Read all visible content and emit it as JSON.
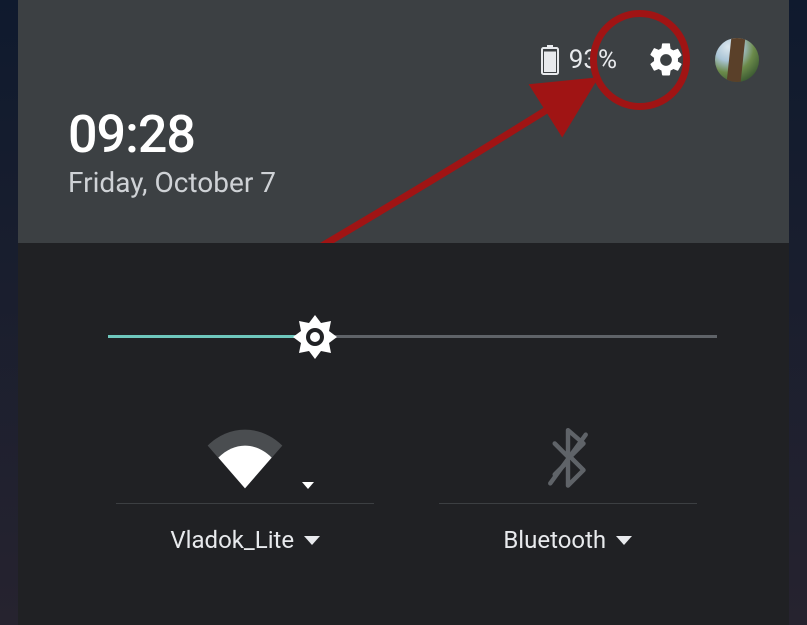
{
  "status": {
    "battery_percent": "93%",
    "icons": {
      "battery": "battery-icon",
      "settings": "gear-icon",
      "avatar": "user-avatar"
    }
  },
  "clock": {
    "time": "09:28",
    "date": "Friday, October 7"
  },
  "brightness": {
    "percent": 34
  },
  "tiles": {
    "wifi": {
      "label": "Vladok_Lite",
      "active": true
    },
    "bluetooth": {
      "label": "Bluetooth",
      "active": false
    }
  },
  "colors": {
    "header_bg": "#3c4043",
    "body_bg": "#202124",
    "accent": "#6ec7bd",
    "annotation": "#a01414"
  }
}
